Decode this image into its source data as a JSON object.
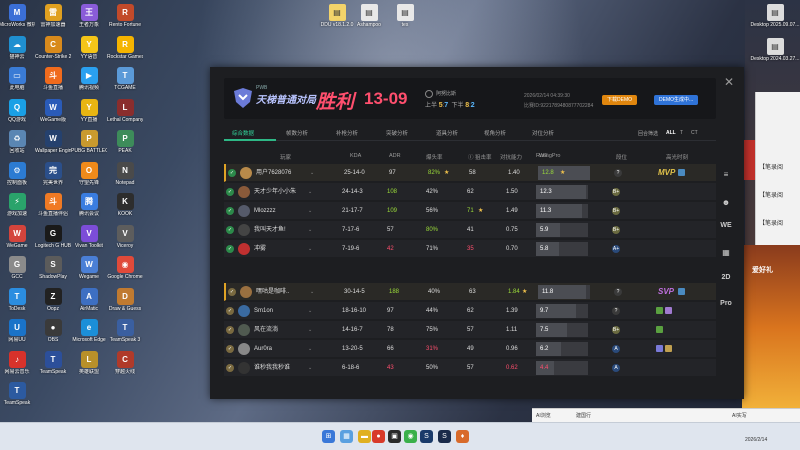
{
  "desktop": {
    "left_icons": [
      {
        "label": "MicroWorks 微机实验",
        "color": "#3b6fd6",
        "glyph": "M"
      },
      {
        "label": "猫神云",
        "color": "#1f8fd0",
        "glyph": "☁"
      },
      {
        "label": "此电脑",
        "color": "#3a7bd5",
        "glyph": "▭"
      },
      {
        "label": "QQ游戏",
        "color": "#1aa0e6",
        "glyph": "Q"
      },
      {
        "label": "回收站",
        "color": "#5a86b3",
        "glyph": "♻"
      },
      {
        "label": "控制面板",
        "color": "#2c7bd2",
        "glyph": "⚙"
      },
      {
        "label": "游戏加速",
        "color": "#2aa36b",
        "glyph": "⚡"
      },
      {
        "label": "WeGame",
        "color": "#d4443c",
        "glyph": "W"
      },
      {
        "label": "GCC",
        "color": "#8b8b8b",
        "glyph": "G"
      },
      {
        "label": "ToDesk",
        "color": "#2b8de0",
        "glyph": "T"
      },
      {
        "label": "网易UU",
        "color": "#1a73c9",
        "glyph": "U"
      },
      {
        "label": "网易云音乐",
        "color": "#d8322b",
        "glyph": "♪"
      },
      {
        "label": "TeamSpeak",
        "color": "#2c5aa0",
        "glyph": "T"
      }
    ],
    "col2_icons": [
      {
        "label": "雷神加速器",
        "color": "#e0a020",
        "glyph": "雷"
      },
      {
        "label": "Counter-Strike 2",
        "color": "#d88a1c",
        "glyph": "C"
      },
      {
        "label": "斗鱼直播",
        "color": "#f06b1d",
        "glyph": "斗"
      },
      {
        "label": "WeGame版",
        "color": "#2a5bb8",
        "glyph": "W"
      },
      {
        "label": "Wallpaper Engine",
        "color": "#25416e",
        "glyph": "W"
      },
      {
        "label": "完美世界",
        "color": "#2b4f8a",
        "glyph": "完"
      },
      {
        "label": "斗鱼直播伴侣",
        "color": "#f07a24",
        "glyph": "斗"
      },
      {
        "label": "Logitech G HUB",
        "color": "#1a1a1a",
        "glyph": "G"
      },
      {
        "label": "ShadowPlay",
        "color": "#5b5b5b",
        "glyph": "S"
      },
      {
        "label": "Oopz",
        "color": "#222222",
        "glyph": "Z"
      },
      {
        "label": "OBS",
        "color": "#3a3a3a",
        "glyph": "●"
      },
      {
        "label": "TeamSpeak",
        "color": "#2c4f9a",
        "glyph": "T"
      }
    ],
    "col3_icons": [
      {
        "label": "王者万象",
        "color": "#8a5cd8",
        "glyph": "王"
      },
      {
        "label": "YY语音",
        "color": "#f5c518",
        "glyph": "Y"
      },
      {
        "label": "腾讯视频",
        "color": "#2aa0f0",
        "glyph": "▶"
      },
      {
        "label": "YY直播",
        "color": "#e8b512",
        "glyph": "Y"
      },
      {
        "label": "PUBG BATTLEG...",
        "color": "#c99a2e",
        "glyph": "P"
      },
      {
        "label": "守望先锋",
        "color": "#f08a1a",
        "glyph": "O"
      },
      {
        "label": "腾讯会议",
        "color": "#3a7de0",
        "glyph": "腾"
      },
      {
        "label": "Vivan Toolkit",
        "color": "#7c4dd8",
        "glyph": "V"
      },
      {
        "label": "Wegame",
        "color": "#4a7fd6",
        "glyph": "W"
      },
      {
        "label": "AirMatic",
        "color": "#3d6fc2",
        "glyph": "A"
      },
      {
        "label": "Microsoft Edge",
        "color": "#1b8fd8",
        "glyph": "e"
      },
      {
        "label": "英雄联盟",
        "color": "#b8902a",
        "glyph": "L"
      }
    ],
    "col4_icons": [
      {
        "label": "Rento Fortune",
        "color": "#c24a2a",
        "glyph": "R"
      },
      {
        "label": "Rockstar Games",
        "color": "#f5b400",
        "glyph": "R"
      },
      {
        "label": "TCGAME",
        "color": "#5b9ad8",
        "glyph": "T"
      },
      {
        "label": "Lethal Company",
        "color": "#8a2d2d",
        "glyph": "L"
      },
      {
        "label": "PEAK",
        "color": "#3d8c5a",
        "glyph": "P"
      },
      {
        "label": "Notepad",
        "color": "#4a4a4a",
        "glyph": "N"
      },
      {
        "label": "KOOK",
        "color": "#2d2d2d",
        "glyph": "K"
      },
      {
        "label": "Viceroy",
        "color": "#5d5d5d",
        "glyph": "V"
      },
      {
        "label": "Google Chrome",
        "color": "#e04a3a",
        "glyph": "◉"
      },
      {
        "label": "Draw & Guess",
        "color": "#c07a30",
        "glyph": "D"
      },
      {
        "label": "TeamSpeak 3",
        "color": "#3a5fa0",
        "glyph": "T"
      },
      {
        "label": "穿越火线",
        "color": "#b03a2a",
        "glyph": "C"
      }
    ],
    "top_files": [
      {
        "label": "DDU v18.1.2.0",
        "color": "#f3d36a"
      },
      {
        "label": "Ashampoo",
        "color": "#e8e8e8"
      },
      {
        "label": "tes",
        "color": "#e8e8e8"
      }
    ],
    "right_files": [
      {
        "label": "Desktop 2025.09.07...",
        "color": "#dcdcdc"
      },
      {
        "label": "Desktop 2024.03.27...",
        "color": "#dcdcdc"
      }
    ]
  },
  "game": {
    "mode_sub": "PWB",
    "mode_title": "天梯普通对局",
    "result": "胜利",
    "score": "13-09",
    "map_name": "阿努比斯",
    "halves": {
      "first_label": "上半",
      "first_ct": "5",
      "first_t": "7",
      "second_label": "下半",
      "second_ct": "8",
      "second_t": "2"
    },
    "date": "2026/02/14 04:39:30",
    "match_id": "比赛ID:9221789480877702284",
    "btn_download": "下载DEMO",
    "btn_generate": "DEMO生成中...",
    "tabs": [
      "综合数据",
      "帧数分析",
      "补枪分析",
      "突破分析",
      "道具分析",
      "视角分析",
      "对位分析"
    ],
    "filters": [
      "回合筛选",
      "ALL",
      "T",
      "CT"
    ],
    "columns": [
      "玩家",
      "KDA",
      "ADR",
      "爆头率",
      "Ⓘ 狙击率",
      "对抗能力",
      "RatingPro",
      "WE",
      "段位",
      "高光时刻"
    ],
    "rail": [
      "≡",
      "☻",
      "WE",
      "▦",
      "2D",
      "Pro"
    ],
    "team_a": [
      {
        "name": "用户7628076",
        "kda": "25-14-0",
        "adr": "97",
        "hs": "82%",
        "hs_star": "★",
        "sniper": "",
        "duel": "58",
        "duel_star": "",
        "rating": "1.40",
        "we": "12.8",
        "we_star": "★",
        "we_pct": 100,
        "rank": "?",
        "rank_color": "#3a3a3a",
        "highlight": "MVP",
        "hl_color": "#e0c24a",
        "self": true,
        "avatar_color": "#b88a4a"
      },
      {
        "name": "天才少年小小朱",
        "kda": "24-14-3",
        "adr": "108",
        "hs": "42%",
        "hs_star": "",
        "sniper": "",
        "duel": "62",
        "duel_star": "",
        "rating": "1.50",
        "we": "12.3",
        "we_star": "",
        "we_pct": 96,
        "rank": "B+",
        "rank_color": "#6a6a40",
        "highlight": "",
        "hl_color": "",
        "self": false,
        "avatar_color": "#8a5a3a"
      },
      {
        "name": "Mlozzzz",
        "kda": "21-17-7",
        "adr": "109",
        "hs": "56%",
        "hs_star": "",
        "sniper": "",
        "duel": "71",
        "duel_star": "★",
        "rating": "1.49",
        "we": "11.3",
        "we_star": "",
        "we_pct": 88,
        "rank": "B+",
        "rank_color": "#6a6a40",
        "highlight": "",
        "hl_color": "",
        "self": false,
        "avatar_color": "#555a6a"
      },
      {
        "name": "我叫天才鱼!",
        "kda": "7-17-6",
        "adr": "57",
        "hs": "80%",
        "hs_star": "",
        "sniper": "",
        "duel": "41",
        "duel_star": "",
        "rating": "0.75",
        "we": "5.9",
        "we_star": "",
        "we_pct": 46,
        "rank": "B+",
        "rank_color": "#6a6a40",
        "highlight": "",
        "hl_color": "",
        "self": false,
        "avatar_color": "#444444"
      },
      {
        "name": "冲雾",
        "kda": "7-19-6",
        "adr": "42",
        "hs": "71%",
        "hs_star": "",
        "sniper": "",
        "duel": "35",
        "duel_star": "",
        "rating": "0.70",
        "we": "5.8",
        "we_star": "",
        "we_pct": 45,
        "rank": "A+",
        "rank_color": "#2a4a7a",
        "highlight": "",
        "hl_color": "",
        "self": false,
        "avatar_color": "#c03030"
      }
    ],
    "team_b": [
      {
        "name": "嘿咕是咖啡..",
        "kda": "30-14-5",
        "adr": "188",
        "hs": "40%",
        "hs_star": "",
        "sniper": "",
        "duel": "63",
        "duel_star": "",
        "rating": "1.84",
        "rating_star": "★",
        "we": "11.8",
        "we_star": "",
        "we_pct": 92,
        "rank": "?",
        "rank_color": "#3a3a3a",
        "highlight": "SVP",
        "hl_color": "#c070e0",
        "self": true,
        "avatar_color": "#9a7040"
      },
      {
        "name": "Sm1on",
        "kda": "18-16-10",
        "adr": "97",
        "hs": "44%",
        "hs_star": "",
        "sniper": "",
        "duel": "62",
        "duel_star": "",
        "rating": "1.39",
        "we": "9.7",
        "we_star": "",
        "we_pct": 76,
        "rank": "?",
        "rank_color": "#3a3a3a",
        "highlight": "",
        "hl_color": "",
        "self": false,
        "avatar_color": "#3a6aa0"
      },
      {
        "name": "风在流淌",
        "kda": "14-16-7",
        "adr": "78",
        "hs": "75%",
        "hs_star": "",
        "sniper": "",
        "duel": "57",
        "duel_star": "",
        "rating": "1.11",
        "we": "7.5",
        "we_star": "",
        "we_pct": 59,
        "rank": "B+",
        "rank_color": "#6a6a40",
        "highlight": "",
        "hl_color": "",
        "self": false,
        "avatar_color": "#505a50"
      },
      {
        "name": "Aur0ra",
        "kda": "13-20-5",
        "adr": "66",
        "hs": "31%",
        "hs_star": "",
        "sniper": "",
        "duel": "49",
        "duel_star": "",
        "rating": "0.96",
        "we": "6.2",
        "we_star": "",
        "we_pct": 48,
        "rank": "A",
        "rank_color": "#2a4a7a",
        "highlight": "",
        "hl_color": "",
        "self": false,
        "avatar_color": "#888888"
      },
      {
        "name": "谁秒我我秒谁",
        "kda": "6-18-6",
        "adr": "43",
        "hs": "50%",
        "hs_star": "",
        "sniper": "",
        "duel": "57",
        "duel_star": "",
        "rating": "0.62",
        "we": "4.4",
        "we_star": "",
        "we_pct": 34,
        "rank": "A",
        "rank_color": "#2a4a7a",
        "highlight": "",
        "hl_color": "",
        "self": false,
        "avatar_color": "#333333"
      }
    ]
  },
  "browser_side": [
    "【笔录阅",
    "【笔录阅",
    "【笔录阅",
    "【笔录阅"
  ],
  "browser_promo": "爱好礼",
  "tray": {
    "chat_label": "AI浏览",
    "input_hint": "搜索",
    "chat_items": [
      "建国行",
      "AI实写"
    ],
    "time": "2026/2/14"
  },
  "taskbar_icons": [
    {
      "color": "#3a78d8",
      "glyph": "⊞"
    },
    {
      "color": "#5aa0e0",
      "glyph": "▦"
    },
    {
      "color": "#e0b020",
      "glyph": "▬"
    },
    {
      "color": "#d83a2a",
      "glyph": "●"
    },
    {
      "color": "#2a2a2a",
      "glyph": "▣"
    },
    {
      "color": "#3ab04a",
      "glyph": "◉"
    },
    {
      "color": "#1a3a6a",
      "glyph": "S"
    },
    {
      "color": "#1a2a4a",
      "glyph": "S"
    },
    {
      "color": "#d86a2a",
      "glyph": "♦"
    }
  ]
}
